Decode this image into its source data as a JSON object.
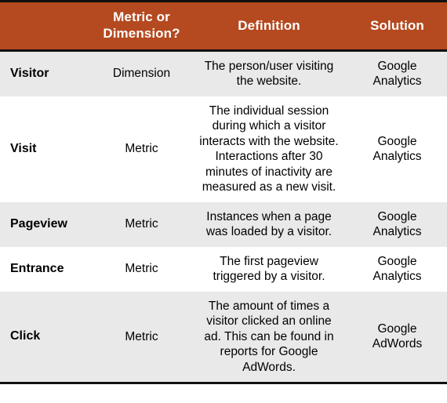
{
  "table": {
    "columns": [
      {
        "key": "term",
        "label": "",
        "align": "left"
      },
      {
        "key": "type",
        "label": "Metric or Dimension?",
        "align": "center"
      },
      {
        "key": "definition",
        "label": "Definition",
        "align": "center"
      },
      {
        "key": "solution",
        "label": "Solution",
        "align": "center"
      }
    ],
    "header": {
      "term": "",
      "type": "Metric or Dimension?",
      "definition": "Definition",
      "solution": "Solution"
    },
    "rows": [
      {
        "term": "Visitor",
        "type": "Dimension",
        "definition": "The person/user visiting the website.",
        "solution": "Google Analytics",
        "shaded": true
      },
      {
        "term": "Visit",
        "type": "Metric",
        "definition": "The individual session during which a visitor interacts with the website. Interactions after 30 minutes of inactivity are measured as a new visit.",
        "solution": "Google Analytics",
        "shaded": false
      },
      {
        "term": "Pageview",
        "type": "Metric",
        "definition": "Instances when a page was loaded by a visitor.",
        "solution": "Google Analytics",
        "shaded": true
      },
      {
        "term": "Entrance",
        "type": "Metric",
        "definition": "The first pageview triggered by a visitor.",
        "solution": "Google Analytics",
        "shaded": false
      },
      {
        "term": "Click",
        "type": "Metric",
        "definition": "The amount of times a visitor clicked an online ad. This can be found in reports for Google AdWords.",
        "solution": "Google AdWords",
        "shaded": true
      }
    ],
    "colors": {
      "header_background": "#b5491f",
      "header_text": "#ffffff",
      "shaded_row_background": "#e9e9e9",
      "plain_row_background": "#ffffff",
      "rule": "#111111",
      "body_text": "#000000"
    }
  }
}
